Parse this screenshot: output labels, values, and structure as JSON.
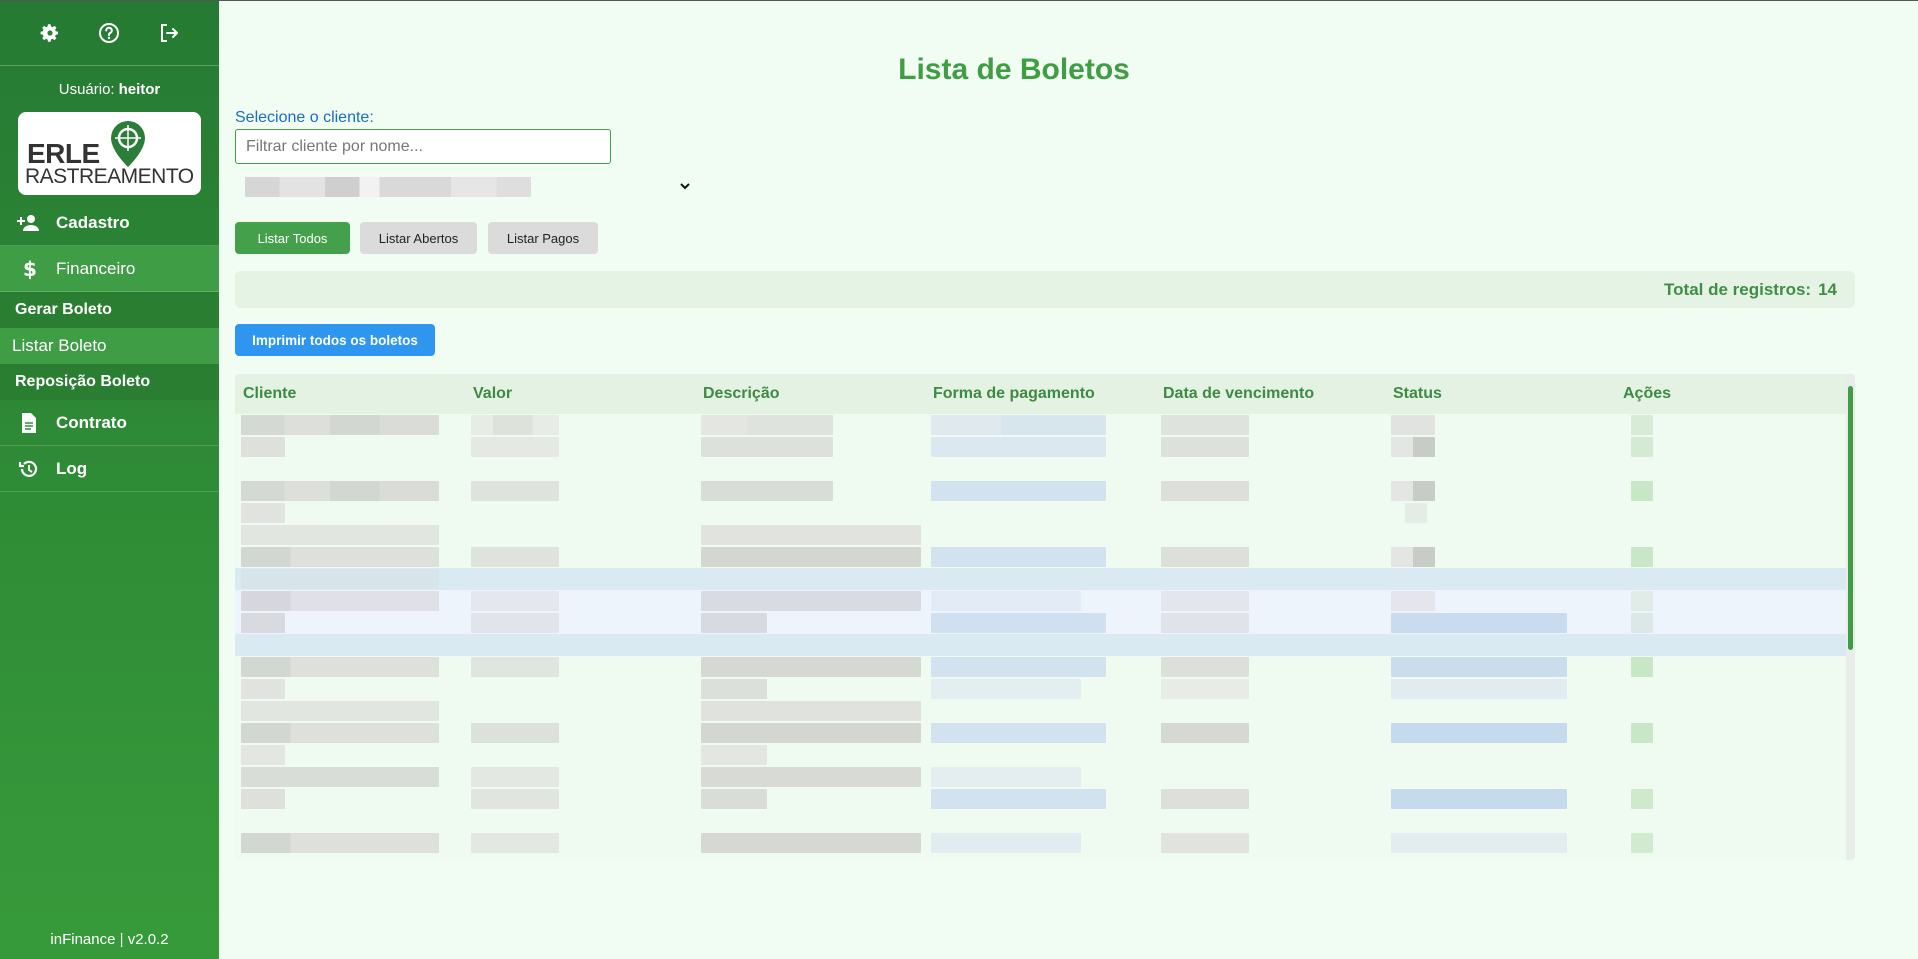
{
  "sidebar": {
    "user_label": "Usuário:",
    "user_name": "heitor",
    "logo": {
      "line1": "ERLE",
      "line2": "RASTREAMENTO"
    },
    "menu": [
      {
        "label": "Cadastro",
        "icon": "user-plus-icon"
      },
      {
        "label": "Financeiro",
        "icon": "dollar-icon"
      },
      {
        "label": "Contrato",
        "icon": "document-icon"
      },
      {
        "label": "Log",
        "icon": "history-icon"
      }
    ],
    "submenu": [
      {
        "label": "Gerar Boleto"
      },
      {
        "label": "Listar Boleto"
      },
      {
        "label": "Reposição Boleto"
      }
    ],
    "version": "inFinance | v2.0.2"
  },
  "main": {
    "title": "Lista de Boletos",
    "select_label": "Selecione o cliente:",
    "filter_placeholder": "Filtrar cliente por nome...",
    "buttons": {
      "listar_todos": "Listar Todos",
      "listar_abertos": "Listar Abertos",
      "listar_pagos": "Listar Pagos",
      "imprimir": "Imprimir todos os boletos"
    },
    "total_label": "Total de registros:",
    "total_value": "14",
    "columns": [
      "Cliente",
      "Valor",
      "Descrição",
      "Forma de pagamento",
      "Data de vencimento",
      "Status",
      "Ações"
    ]
  },
  "colors": {
    "sidebar_green": "#2f8d36",
    "title_green": "#3f9d44",
    "accent_blue": "#2f96f0",
    "background": "#f1fcf2"
  }
}
